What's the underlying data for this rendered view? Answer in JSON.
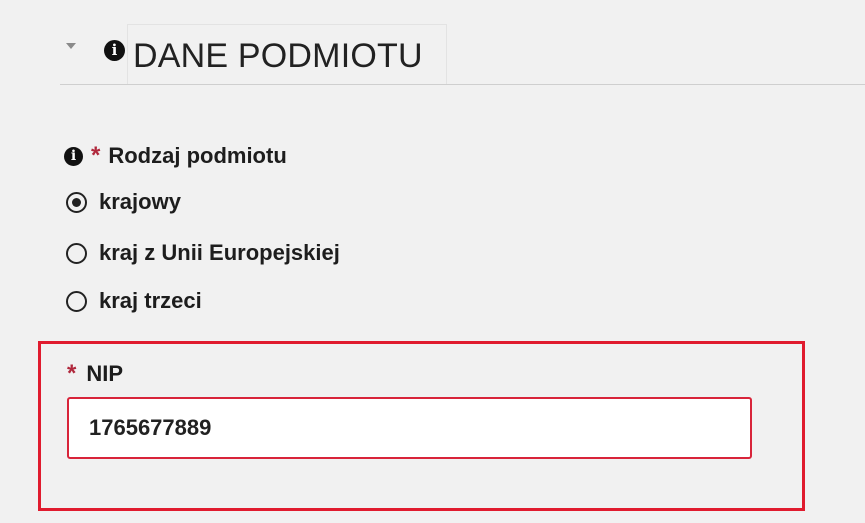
{
  "section": {
    "title": "DANE PODMIOTU",
    "info_glyph": "i"
  },
  "entity_type": {
    "required_mark": "*",
    "label": "Rodzaj podmiotu",
    "info_glyph": "i",
    "options": [
      {
        "label": "krajowy",
        "selected": true
      },
      {
        "label": "kraj z Unii Europejskiej",
        "selected": false
      },
      {
        "label": "kraj trzeci",
        "selected": false
      }
    ]
  },
  "nip": {
    "required_mark": "*",
    "label": "NIP",
    "value": "1765677889"
  },
  "colors": {
    "required": "#b0283c",
    "highlight": "#e01b2e",
    "background": "#f1f1f1"
  }
}
